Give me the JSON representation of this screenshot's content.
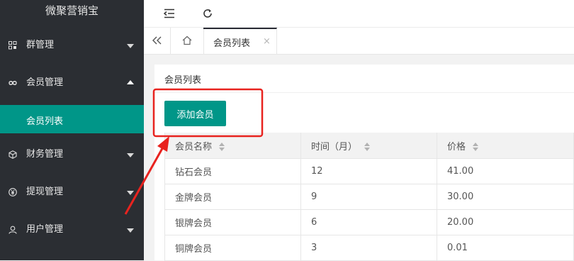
{
  "app": {
    "title": "微聚营销宝"
  },
  "sidebar": {
    "items": [
      {
        "label": "群管理",
        "icon": "grid-icon",
        "expanded": false
      },
      {
        "label": "会员管理",
        "icon": "infinity-icon",
        "expanded": true,
        "children": [
          {
            "label": "会员列表",
            "active": true
          }
        ]
      },
      {
        "label": "财务管理",
        "icon": "cube-icon",
        "expanded": false
      },
      {
        "label": "提现管理",
        "icon": "yen-icon",
        "expanded": false
      },
      {
        "label": "用户管理",
        "icon": "user-icon",
        "expanded": false
      }
    ]
  },
  "topbar": {
    "icons": [
      "indent-icon",
      "refresh-icon"
    ]
  },
  "tabs": {
    "left_icon": "double-chevron-left-icon",
    "home_icon": "home-icon",
    "active": {
      "label": "会员列表",
      "close": "×"
    }
  },
  "card": {
    "title": "会员列表",
    "add_button": "添加会员"
  },
  "table": {
    "columns": [
      "会员名称",
      "时间（月）",
      "价格"
    ],
    "rows": [
      [
        "钻石会员",
        "12",
        "41.00"
      ],
      [
        "金牌会员",
        "9",
        "30.00"
      ],
      [
        "银牌会员",
        "6",
        "20.00"
      ],
      [
        "铜牌会员",
        "3",
        "0.01"
      ]
    ]
  },
  "annotation": {
    "color": "#e8231f"
  }
}
